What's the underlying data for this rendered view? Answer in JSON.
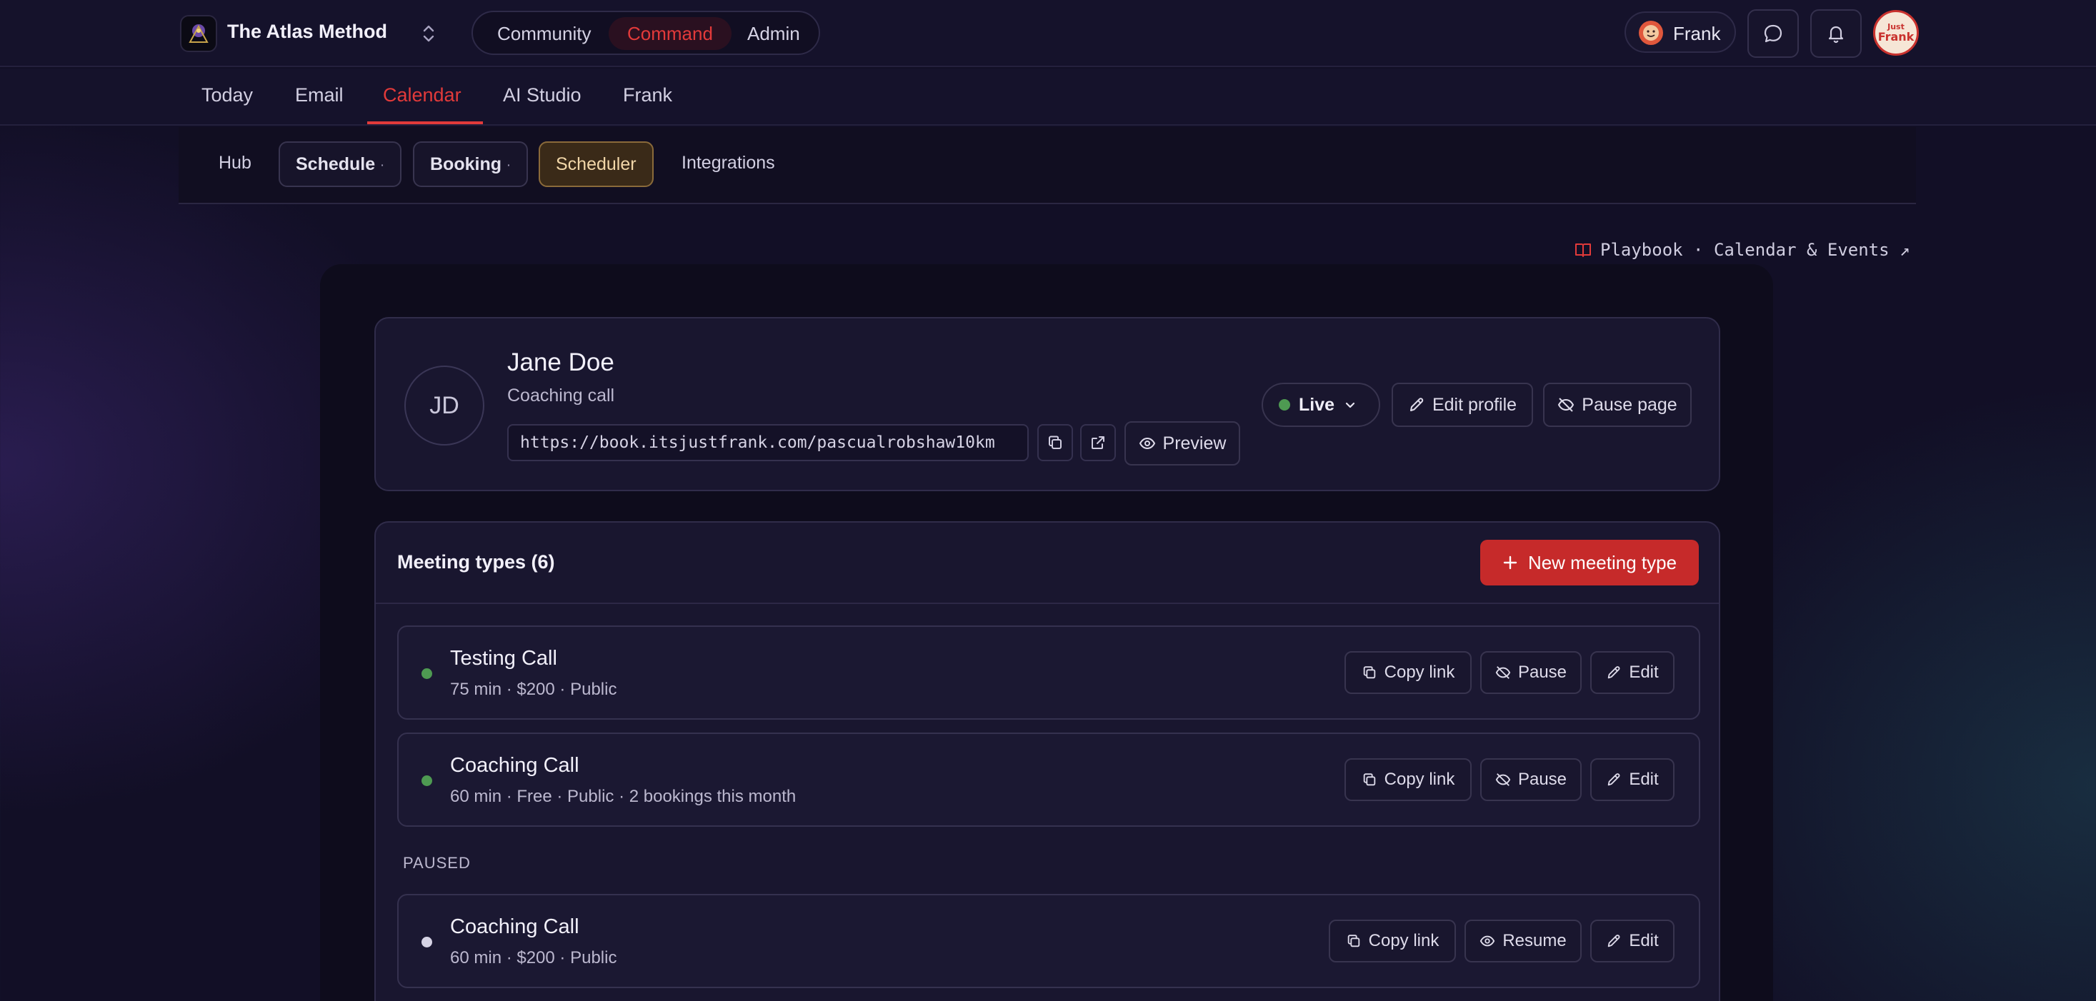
{
  "header": {
    "app_name": "The Atlas Method",
    "modes": [
      "Community",
      "Command",
      "Admin"
    ],
    "active_mode": "Command",
    "user_name": "Frank",
    "avatar_text": "Just Frank"
  },
  "nav": {
    "items": [
      "Today",
      "Email",
      "Calendar",
      "AI Studio",
      "Frank"
    ],
    "active": "Calendar"
  },
  "subnav": {
    "items": [
      "Hub",
      "Schedule",
      "Booking",
      "Scheduler",
      "Integrations"
    ],
    "dropdown_marker": "·"
  },
  "playbook_link": "Playbook · Calendar & Events ↗",
  "profile": {
    "initials": "JD",
    "name": "Jane Doe",
    "subtitle": "Coaching call",
    "url": "https://book.itsjustfrank.com/pascualrobshaw10km",
    "preview_label": "Preview",
    "status_label": "Live",
    "edit_profile_label": "Edit profile",
    "pause_page_label": "Pause page"
  },
  "meeting_types": {
    "title": "Meeting types (6)",
    "new_button": "New meeting type",
    "paused_label": "PAUSED",
    "colors": {
      "active": "#4e9a52",
      "paused": "#d6d3e5",
      "accent": "#c62a2a"
    },
    "active_items": [
      {
        "name": "Testing Call",
        "meta": "75 min · $200 · Public",
        "copy": "Copy link",
        "toggle": "Pause",
        "edit": "Edit"
      },
      {
        "name": "Coaching Call",
        "meta": "60 min · Free · Public · 2 bookings this month",
        "copy": "Copy link",
        "toggle": "Pause",
        "edit": "Edit"
      }
    ],
    "paused_items": [
      {
        "name": "Coaching Call",
        "meta": "60 min · $200 · Public",
        "copy": "Copy link",
        "toggle": "Resume",
        "edit": "Edit"
      }
    ]
  }
}
